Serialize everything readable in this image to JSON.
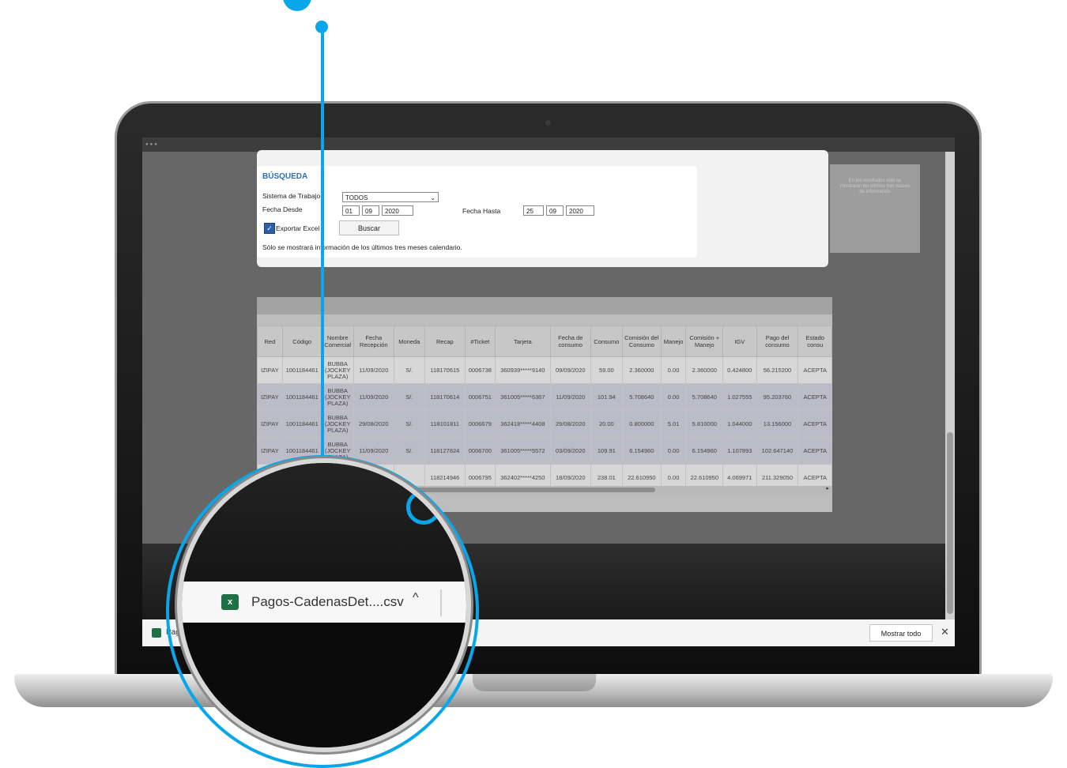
{
  "search": {
    "title": "BÚSQUEDA",
    "sistema_label": "Sistema de Trabajo",
    "sistema_value": "TODOS",
    "fecha_desde_label": "Fecha Desde",
    "fecha_desde": [
      "01",
      "09",
      "2020"
    ],
    "fecha_hasta_label": "Fecha Hasta",
    "fecha_hasta": [
      "25",
      "09",
      "2020"
    ],
    "export_label": "Exportar Excel",
    "export_checked": true,
    "buscar_label": "Buscar",
    "note": "Sólo se mostrará información de los últimos tres meses calendario."
  },
  "side_box": {
    "text": "En los resultados sólo se mostrarán los últimos tres meses de información"
  },
  "table": {
    "headers": [
      "Red",
      "Código",
      "Nombre Comercial",
      "Fecha Recepción",
      "Moneda",
      "Recap",
      "#Ticket",
      "Tarjeta",
      "Fecha de consumo",
      "Consumo",
      "Comisión del Consumo",
      "Manejo",
      "Comisión + Manejo",
      "IGV",
      "Pago del consumo",
      "Estado consu"
    ],
    "rows": [
      [
        "IZIPAY",
        "1001184461",
        "BUBBA (JOCKEY PLAZA)",
        "11/09/2020",
        "S/.",
        "118170615",
        "0006738",
        "360939*****9140",
        "09/09/2020",
        "59.00",
        "2.360000",
        "0.00",
        "2.360000",
        "0.424800",
        "56.215200",
        "ACEPTA"
      ],
      [
        "IZIPAY",
        "1001184461",
        "BUBBA (JOCKEY PLAZA)",
        "11/09/2020",
        "S/.",
        "118170614",
        "0006751",
        "361005*****6367",
        "11/09/2020",
        "101.94",
        "5.708640",
        "0.00",
        "5.708640",
        "1.027555",
        "95.203760",
        "ACEPTA"
      ],
      [
        "IZIPAY",
        "1001184461",
        "BUBBA (JOCKEY PLAZA)",
        "29/08/2020",
        "S/.",
        "118101811",
        "0006679",
        "362418*****4408",
        "29/08/2020",
        "20.00",
        "0.800000",
        "5.01",
        "5.810000",
        "1.044000",
        "13.156000",
        "ACEPTA"
      ],
      [
        "IZIPAY",
        "1001184461",
        "BUBBA (JOCKEY PLAZA)",
        "11/09/2020",
        "S/.",
        "118127824",
        "0006700",
        "361005*****5572",
        "03/09/2020",
        "109.91",
        "6.154960",
        "0.00",
        "6.154960",
        "1.107893",
        "102.647140",
        "ACEPTA"
      ],
      [
        "",
        "",
        "",
        "",
        "",
        "118214946",
        "0006795",
        "362402*****4250",
        "18/09/2020",
        "238.01",
        "22.610950",
        "0.00",
        "22.610950",
        "4.069971",
        "211.329050",
        "ACEPTA"
      ]
    ]
  },
  "download": {
    "file_name": "Pagos-CadenasDet....csv",
    "bar_file_short": "Pagos",
    "mostrar_todo": "Mostrar todo",
    "close_symbol": "✕",
    "chevron": "^",
    "icon": "excel-file-icon"
  },
  "colors": {
    "accent": "#0aa6ea",
    "excel": "#1e7145",
    "title_blue": "#2d6fb3"
  }
}
